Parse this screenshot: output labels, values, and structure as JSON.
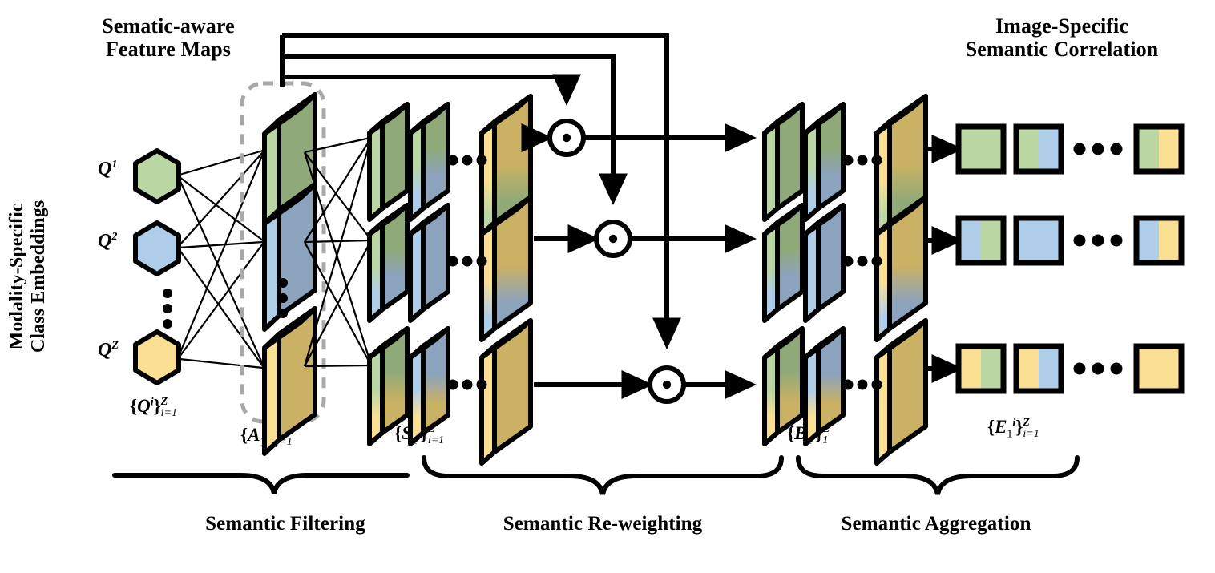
{
  "figure": {
    "title_top_left": "Sematic-aware\nFeature Maps",
    "title_top_right": "Image-Specific\nSemantic Correlation",
    "side_label": "Modality-Specific\nClass Embeddings"
  },
  "colors": {
    "green": "#b9d6a3",
    "blue": "#aecde8",
    "yellow": "#fadf92",
    "green_face": "#8faa78",
    "blue_face": "#8ca3bd",
    "yellow_face": "#cbb163",
    "outline": "#000000",
    "dashed_box": "#a8a8a8",
    "background": "#ffffff"
  },
  "embeddings": {
    "items": [
      {
        "label": "Q",
        "sup": "1",
        "color": "green"
      },
      {
        "label": "Q",
        "sup": "2",
        "color": "blue"
      },
      {
        "label": "Q",
        "sup": "Z",
        "color": "yellow"
      }
    ],
    "vertical_dots": "⋮",
    "caption": {
      "base": "{Q",
      "sup": "i",
      "close": "}",
      "upper": "Z",
      "lower": "i=1"
    }
  },
  "columns": {
    "A": {
      "caption": {
        "base": "{A",
        "sub": "1",
        "sup": "j",
        "close": "}",
        "upper": "Z",
        "lower": "j=1"
      }
    },
    "S": {
      "caption": {
        "base": "{S",
        "sub": "1",
        "sup": "i",
        "close": "}",
        "upper": "Z",
        "lower": "i=1"
      }
    },
    "B": {
      "caption": {
        "base": "{B",
        "sub": "1",
        "sup": "i",
        "close": "}",
        "upper": "Z",
        "lower": "1"
      }
    },
    "E": {
      "caption": {
        "base": "{E",
        "sub": "1",
        "sup": "i",
        "close": "}",
        "upper": "Z",
        "lower": "i=1"
      }
    }
  },
  "operator": {
    "symbol": "⊙",
    "name": "hadamard-product"
  },
  "ellipsis_dots": "•••",
  "phases": [
    {
      "label": "Semantic Filtering"
    },
    {
      "label": "Semantic Re-weighting"
    },
    {
      "label": "Semantic Aggregation"
    }
  ],
  "chart_data": {
    "type": "diagram",
    "rows": 3,
    "stages": [
      "Q embeddings",
      "A feature maps",
      "S re-weighted maps",
      "hadamard",
      "B aggregated maps",
      "E correlation vectors"
    ],
    "A_cards": [
      {
        "row": 1,
        "color": "green"
      },
      {
        "row": 2,
        "color": "blue"
      },
      {
        "row": 3,
        "color": "yellow"
      }
    ],
    "S_cards": [
      {
        "row": 1,
        "cards": [
          "green",
          "green-blue",
          "yellow-green"
        ]
      },
      {
        "row": 2,
        "cards": [
          "green-blue",
          "blue",
          "yellow-blue"
        ]
      },
      {
        "row": 3,
        "cards": [
          "green-yellow",
          "blue-yellow",
          "yellow"
        ]
      }
    ],
    "B_cards": [
      {
        "row": 1,
        "cards": [
          "green",
          "green-blue",
          "yellow-green"
        ]
      },
      {
        "row": 2,
        "cards": [
          "green-blue",
          "blue",
          "yellow-blue"
        ]
      },
      {
        "row": 3,
        "cards": [
          "green-yellow",
          "blue-yellow",
          "yellow"
        ]
      }
    ],
    "E_squares": [
      {
        "row": 1,
        "squares": [
          [
            "green",
            "green"
          ],
          [
            "green",
            "blue"
          ],
          [
            "green",
            "yellow"
          ]
        ]
      },
      {
        "row": 2,
        "squares": [
          [
            "blue",
            "green"
          ],
          [
            "blue",
            "blue"
          ],
          [
            "blue",
            "yellow"
          ]
        ]
      },
      {
        "row": 3,
        "squares": [
          [
            "yellow",
            "green"
          ],
          [
            "yellow",
            "blue"
          ],
          [
            "yellow",
            "yellow"
          ]
        ]
      }
    ]
  }
}
